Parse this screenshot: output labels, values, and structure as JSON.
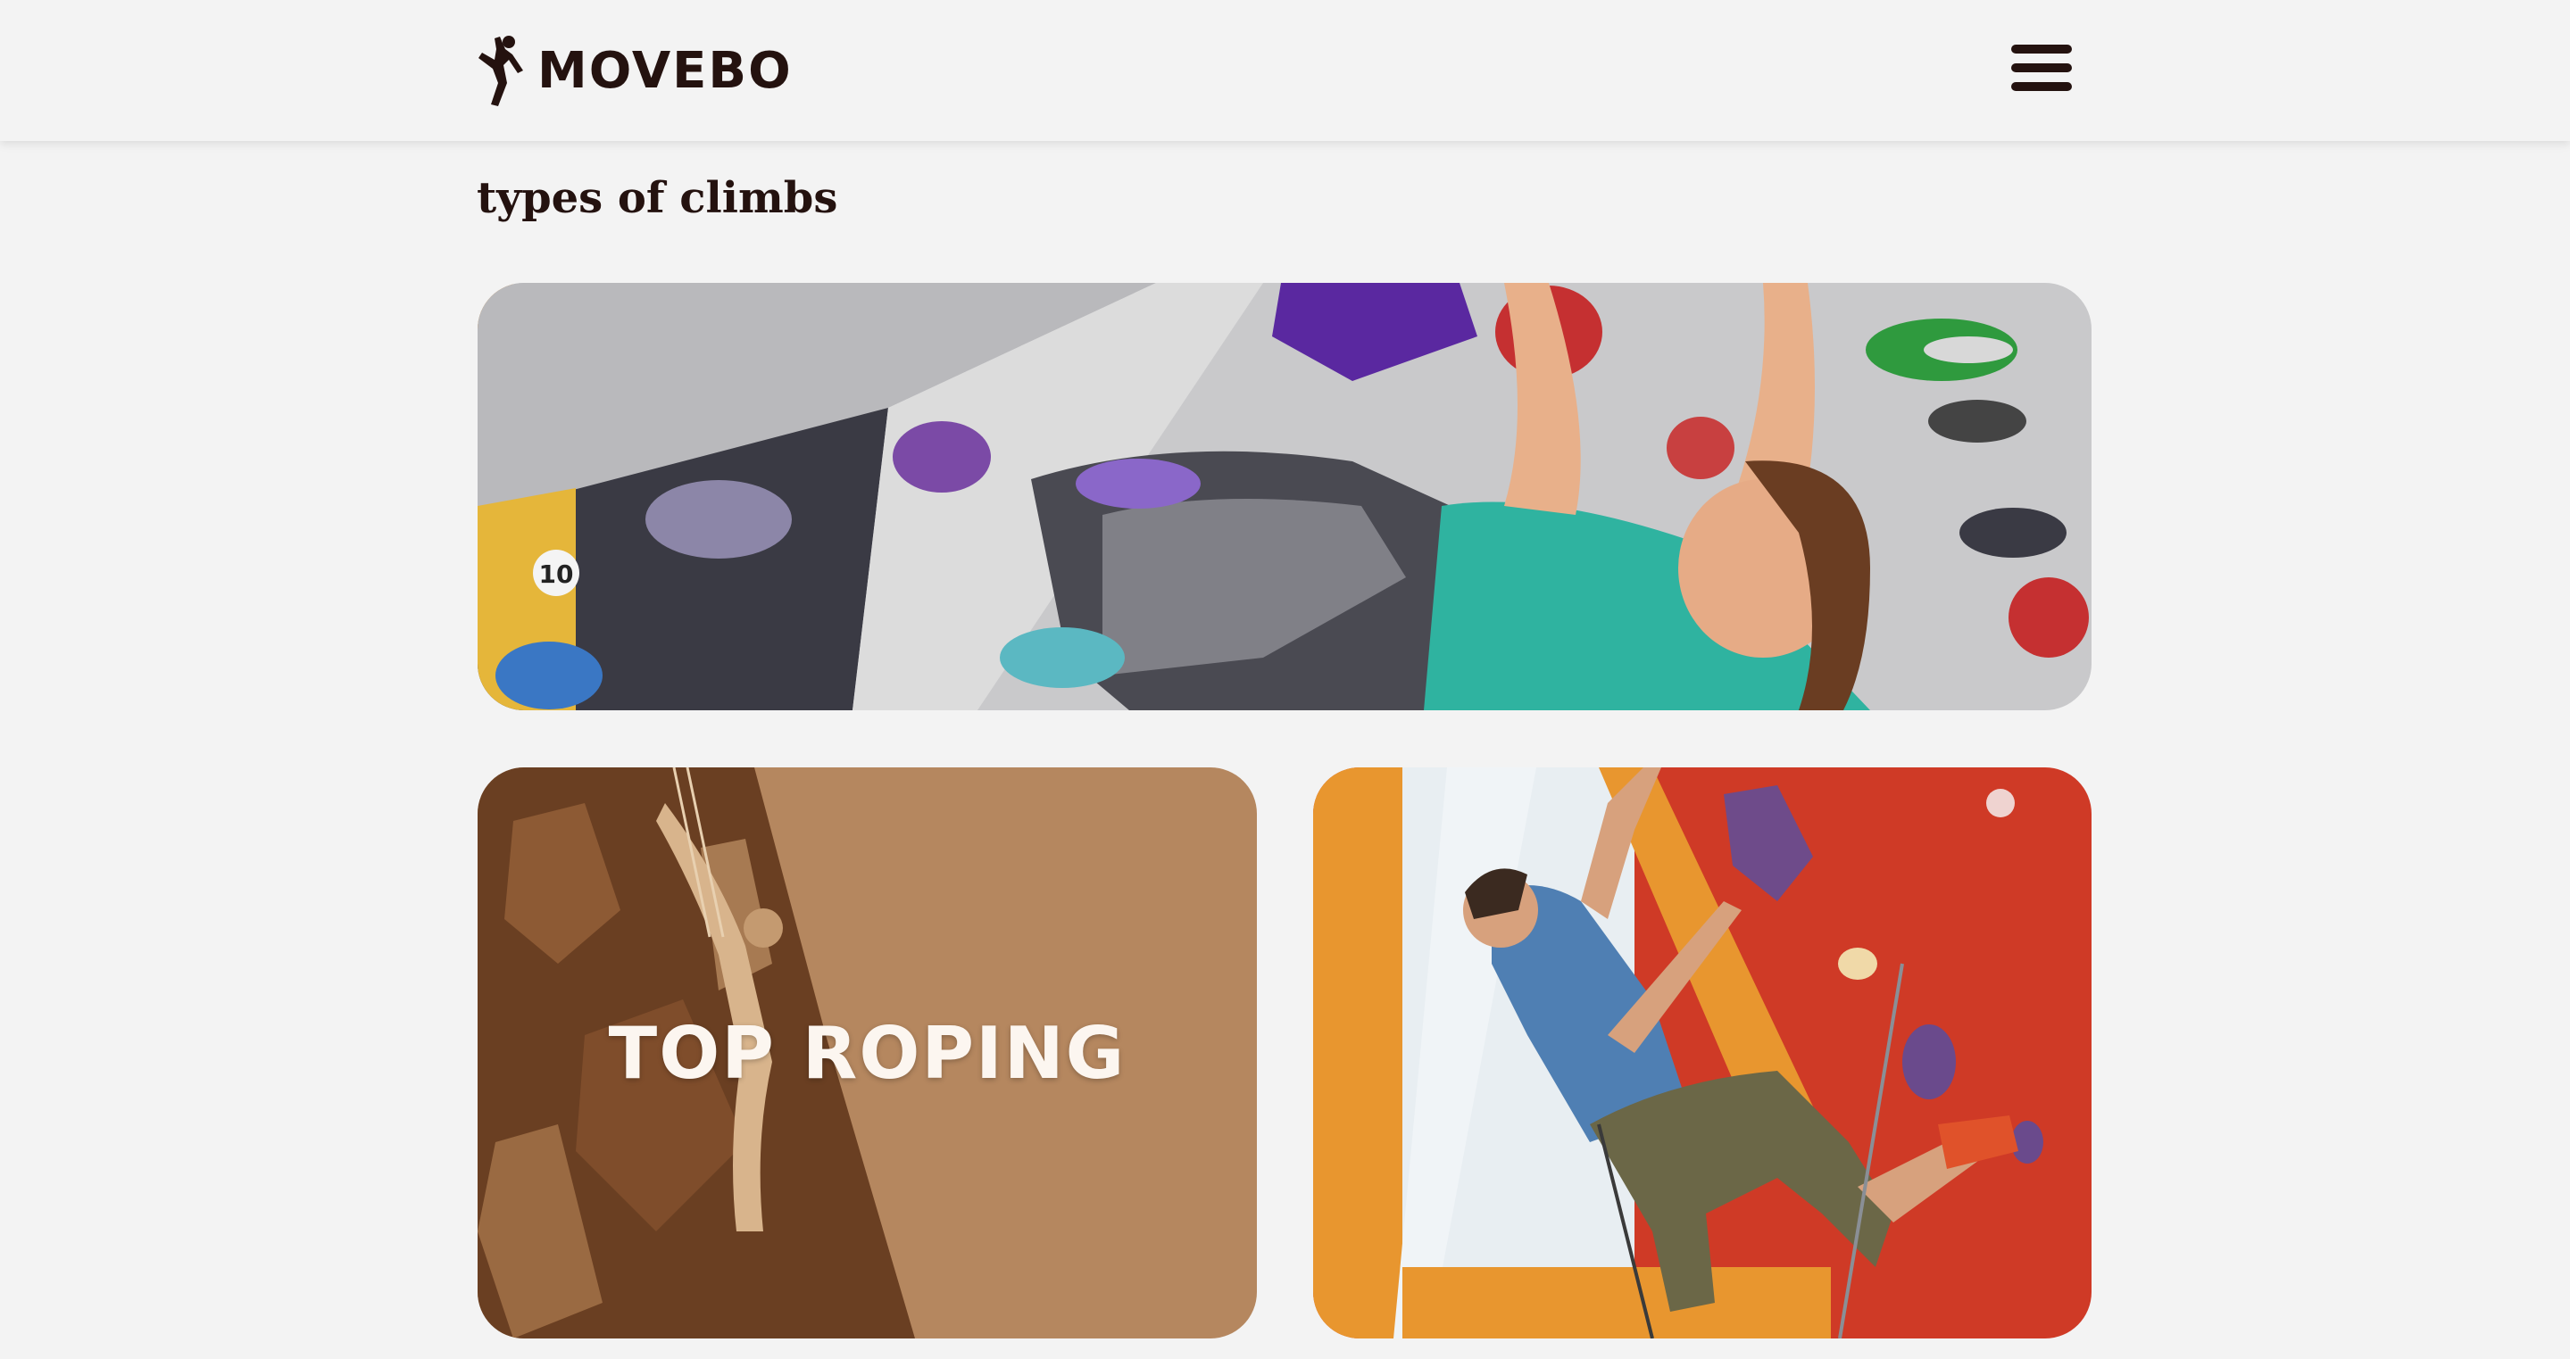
{
  "header": {
    "brand": "MOVEBO",
    "logo_icon": "climber-icon",
    "menu_icon": "hamburger-menu-icon"
  },
  "main": {
    "title": "types of climbs",
    "cards": [
      {
        "image": "indoor-bouldering-climber-photo",
        "label": ""
      },
      {
        "image": "outdoor-rock-wall-climber-photo",
        "label": "TOP ROPING"
      },
      {
        "image": "red-gym-wall-climber-photo",
        "label": ""
      }
    ]
  },
  "colors": {
    "background": "#f3f3f3",
    "text": "#24120f",
    "card_overlay": "#b5875f",
    "wall_red": "#cf3a26",
    "wall_orange": "#e8962f"
  }
}
